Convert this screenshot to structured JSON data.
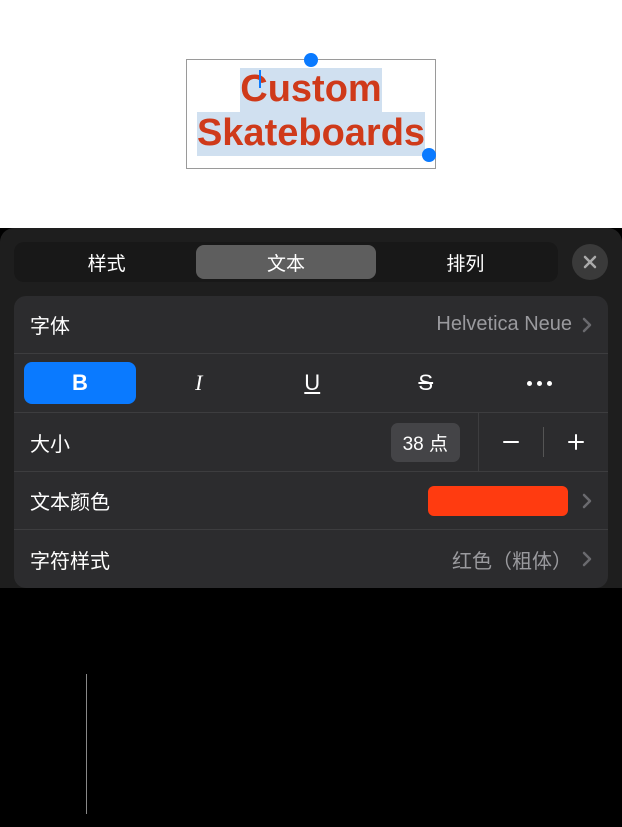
{
  "canvas": {
    "text_line1": "Custom",
    "text_line2": "Skateboards",
    "text_color": "#cf3a1a",
    "highlight_color": "#d0e0f0"
  },
  "tabs": {
    "style": "样式",
    "text": "文本",
    "arrange": "排列"
  },
  "font": {
    "label": "字体",
    "value": "Helvetica Neue"
  },
  "style_buttons": {
    "bold": "B",
    "italic": "I",
    "underline": "U",
    "strike": "S"
  },
  "size": {
    "label": "大小",
    "value": "38 点"
  },
  "text_color": {
    "label": "文本颜色",
    "value": "#ff3b10"
  },
  "char_style": {
    "label": "字符样式",
    "value": "红色（粗体）"
  }
}
